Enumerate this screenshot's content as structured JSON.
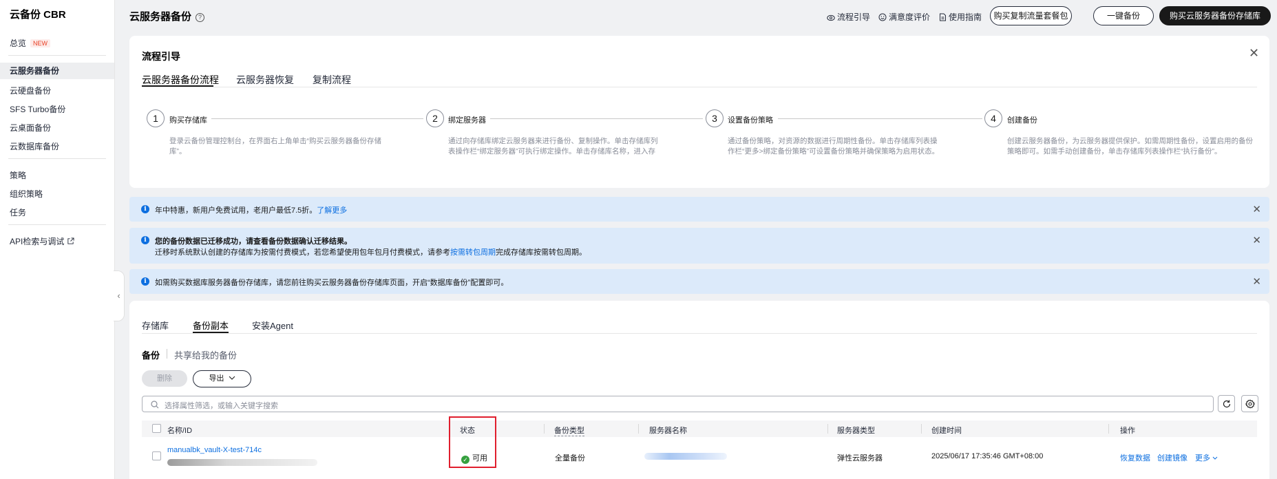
{
  "sidebar": {
    "title": "云备份 CBR",
    "overview": "总览",
    "new_badge": "NEW",
    "items": [
      {
        "label": "云服务器备份"
      },
      {
        "label": "云硬盘备份"
      },
      {
        "label": "SFS Turbo备份"
      },
      {
        "label": "云桌面备份"
      },
      {
        "label": "云数据库备份"
      },
      {
        "label": "策略"
      },
      {
        "label": "组织策略"
      },
      {
        "label": "任务"
      },
      {
        "label": "API检索与调试"
      }
    ]
  },
  "header": {
    "title": "云服务器备份",
    "links": [
      "流程引导",
      "满意度评价",
      "使用指南"
    ],
    "buttons": [
      "购买复制流量套餐包",
      "一键备份",
      "购买云服务器备份存储库"
    ]
  },
  "guide": {
    "title": "流程引导",
    "tabs": [
      "云服务器备份流程",
      "云服务器恢复",
      "复制流程"
    ],
    "steps": [
      {
        "num": "1",
        "title": "购买存储库",
        "desc": "登录云备份管理控制台，在界面右上角单击“购买云服务器备份存储库”。"
      },
      {
        "num": "2",
        "title": "绑定服务器",
        "desc": "通过向存储库绑定云服务器来进行备份、复制操作。单击存储库列表操作栏“绑定服务器”可执行绑定操作。单击存储库名称，进入存储库详情页中可以..."
      },
      {
        "num": "3",
        "title": "设置备份策略",
        "desc": "通过备份策略，对资源的数据进行周期性备份。单击存储库列表操作栏“更多>绑定备份策略”可设置备份策略并确保策略为启用状态。"
      },
      {
        "num": "4",
        "title": "创建备份",
        "desc": "创建云服务器备份，为云服务器提供保护。如需周期性备份，设置启用的备份策略即可。如需手动创建备份，单击存储库列表操作栏“执行备份”。"
      }
    ]
  },
  "notices": [
    {
      "text": "年中特惠，新用户免费试用，老用户最低7.5折。",
      "link": "了解更多"
    },
    {
      "bold": "您的备份数据已迁移成功，请查看备份数据确认迁移结果。",
      "line2_pre": "迁移时系统默认创建的存储库为按需付费模式，若您希望使用包年包月付费模式，请参考",
      "line2_link": "按需转包周期",
      "line2_post": "完成存储库按需转包周期。"
    },
    {
      "text": "如需购买数据库服务器备份存储库，请您前往购买云服务器备份存储库页面，开启“数据库备份”配置即可。"
    }
  ],
  "main": {
    "tabs": [
      "存储库",
      "备份副本",
      "安装Agent"
    ],
    "subtabs": [
      "备份",
      "共享给我的备份"
    ],
    "delete_label": "删除",
    "export_label": "导出",
    "search_placeholder": "选择属性筛选，或输入关键字搜索",
    "columns": [
      "名称/ID",
      "状态",
      "备份类型",
      "服务器名称",
      "服务器类型",
      "创建时间",
      "操作"
    ],
    "rows": [
      {
        "name": "manualbk_vault-X-test-714c",
        "status": "可用",
        "backup_type": "全量备份",
        "server_type": "弹性云服务器",
        "created": "2025/06/17 17:35:46 GMT+08:00",
        "actions": [
          "恢复数据",
          "创建镜像",
          "更多"
        ]
      }
    ]
  },
  "colors": {
    "primary": "#191919",
    "link": "#0d6fe0",
    "notice_bg": "#dceafa",
    "success": "#35a03e",
    "highlight": "#e01e2d"
  }
}
